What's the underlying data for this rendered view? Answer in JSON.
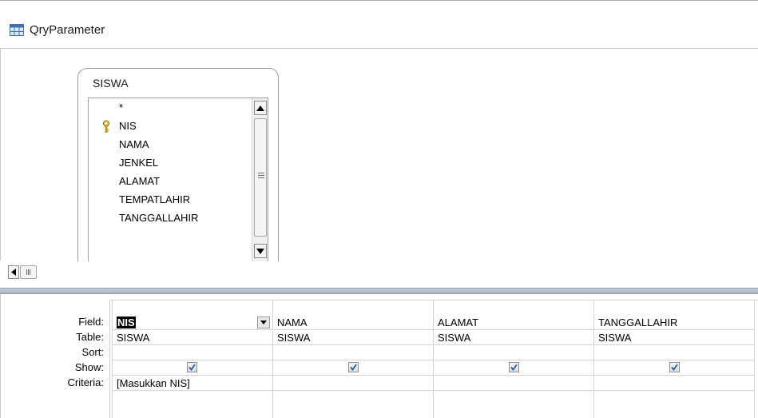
{
  "window": {
    "title": "QryParameter"
  },
  "table_box": {
    "name": "SISWA",
    "fields": [
      "*",
      "NIS",
      "NAMA",
      "JENKEL",
      "ALAMAT",
      "TEMPATLAHIR",
      "TANGGALLAHIR"
    ],
    "primary_key_field": "NIS"
  },
  "grid": {
    "row_labels": {
      "field": "Field:",
      "table": "Table:",
      "sort": "Sort:",
      "show": "Show:",
      "criteria": "Criteria:"
    },
    "columns": [
      {
        "field": "NIS",
        "table": "SISWA",
        "sort": "",
        "show": true,
        "criteria": "[Masukkan NIS]",
        "selected": true
      },
      {
        "field": "NAMA",
        "table": "SISWA",
        "sort": "",
        "show": true,
        "criteria": ""
      },
      {
        "field": "ALAMAT",
        "table": "SISWA",
        "sort": "",
        "show": true,
        "criteria": ""
      },
      {
        "field": "TANGGALLAHIR",
        "table": "SISWA",
        "sort": "",
        "show": true,
        "criteria": ""
      }
    ]
  },
  "icons": {
    "title": "query-design-icon",
    "key": "primary-key-icon",
    "scroll_up": "scroll-up-arrow-icon",
    "scroll_down": "scroll-down-arrow-icon",
    "scroll_left": "scroll-left-arrow-icon",
    "dropdown": "dropdown-arrow-icon",
    "checkbox": "checkmark-icon"
  },
  "colors": {
    "splitter": "#aab4c4",
    "selection": "#000000",
    "border": "#d4d4d4"
  }
}
